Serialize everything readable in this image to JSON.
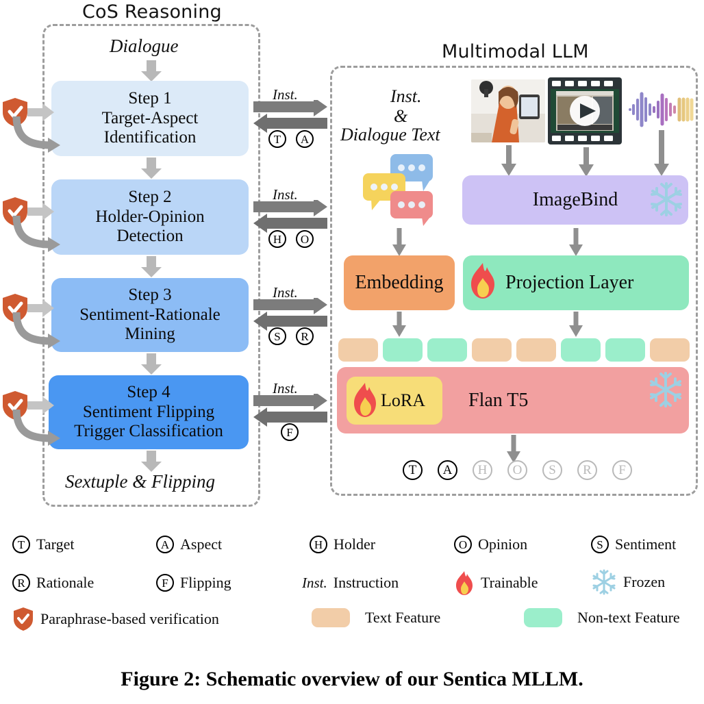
{
  "figure": {
    "caption": "Figure 2: Schematic overview of our Sentica MLLM."
  },
  "left_panel": {
    "title": "CoS Reasoning",
    "input_label": "Dialogue",
    "output_label": "Sextuple & Flipping",
    "steps": [
      {
        "index": "Step 1",
        "name_line1": "Target-Aspect",
        "name_line2": "Identification",
        "color": "#dceaf8"
      },
      {
        "index": "Step 2",
        "name_line1": "Holder-Opinion",
        "name_line2": "Detection",
        "color": "#bad6f7"
      },
      {
        "index": "Step 3",
        "name_line1": "Sentiment-Rationale",
        "name_line2": "Mining",
        "color": "#8cbcf5"
      },
      {
        "index": "Step 4",
        "name_line1": "Sentiment Flipping",
        "name_line2": "Trigger Classification",
        "color": "#4a97f2"
      }
    ],
    "verification_icon": "shield-check-icon"
  },
  "bridge": {
    "instruction_label": "Inst.",
    "returns": [
      {
        "tokens": [
          "T",
          "A"
        ]
      },
      {
        "tokens": [
          "H",
          "O"
        ]
      },
      {
        "tokens": [
          "S",
          "R"
        ]
      },
      {
        "tokens": [
          "F"
        ]
      }
    ]
  },
  "right_panel": {
    "title": "Multimodal LLM",
    "text_input_label_line1": "Inst.",
    "text_input_label_line2": "&",
    "text_input_label_line3": "Dialogue Text",
    "chat_icon": "speech-bubbles-icon",
    "modalities": [
      {
        "name": "image-thumbnail",
        "type": "image"
      },
      {
        "name": "video-thumbnail",
        "type": "video"
      },
      {
        "name": "audio-waveform",
        "type": "audio"
      }
    ],
    "blocks": {
      "imagebind": {
        "label": "ImageBind",
        "color": "#cdc2f5",
        "state": "frozen",
        "state_icon": "snowflake-icon"
      },
      "embedding": {
        "label": "Embedding",
        "color": "#f2a26a"
      },
      "projection": {
        "label": "Projection Layer",
        "color": "#8ee8be",
        "state": "trainable",
        "state_icon": "fire-icon"
      },
      "backbone": {
        "label": "Flan T5",
        "color": "#f2a0a0",
        "state": "frozen",
        "state_icon": "snowflake-icon"
      },
      "lora": {
        "label": "LoRA",
        "color": "#f7dd78",
        "state": "trainable",
        "state_icon": "fire-icon"
      }
    },
    "feature_tokens": [
      "text",
      "nontext",
      "nontext",
      "text",
      "text",
      "nontext",
      "nontext",
      "text"
    ],
    "output_tokens": [
      {
        "letter": "T",
        "active": true
      },
      {
        "letter": "A",
        "active": true
      },
      {
        "letter": "H",
        "active": false
      },
      {
        "letter": "O",
        "active": false
      },
      {
        "letter": "S",
        "active": false
      },
      {
        "letter": "R",
        "active": false
      },
      {
        "letter": "F",
        "active": false
      }
    ]
  },
  "legend": {
    "rows": [
      [
        {
          "icon": "circled-T",
          "letter": "T",
          "label": "Target"
        },
        {
          "icon": "circled-A",
          "letter": "A",
          "label": "Aspect"
        },
        {
          "icon": "circled-H",
          "letter": "H",
          "label": "Holder"
        },
        {
          "icon": "circled-O",
          "letter": "O",
          "label": "Opinion"
        },
        {
          "icon": "circled-S",
          "letter": "S",
          "label": "Sentiment"
        }
      ],
      [
        {
          "icon": "circled-R",
          "letter": "R",
          "label": "Rationale"
        },
        {
          "icon": "circled-F",
          "letter": "F",
          "label": "Flipping"
        },
        {
          "icon": "inst-italic",
          "letter": "Inst.",
          "label": "Instruction"
        },
        {
          "icon": "fire-icon",
          "letter": "",
          "label": "Trainable"
        },
        {
          "icon": "snowflake-icon",
          "letter": "",
          "label": "Frozen"
        }
      ],
      [
        {
          "icon": "shield-check-icon",
          "letter": "",
          "label": "Paraphrase-based verification"
        },
        {
          "icon": "swatch-text",
          "letter": "",
          "label": "Text Feature"
        },
        {
          "icon": "swatch-nontext",
          "letter": "",
          "label": "Non-text Feature"
        }
      ]
    ]
  },
  "colors": {
    "text_feature": "#f2cda8",
    "nontext_feature": "#9beecb",
    "shield": "#cf5a31",
    "arrow_gray": "#8f8f8f",
    "arrow_dark": "#6f6f6f",
    "dashed_border": "#9d9d9d",
    "snowflake": "#9dd0e3",
    "fire_outer": "#ef4d4d",
    "fire_inner": "#f7cf50"
  }
}
